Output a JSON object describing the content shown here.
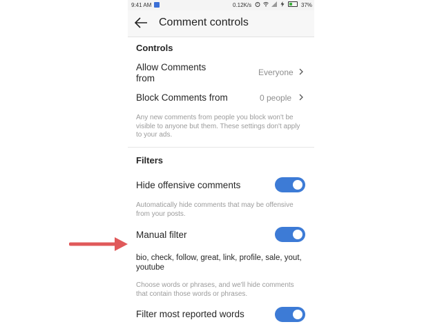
{
  "status_bar": {
    "time": "9:41 AM",
    "speed": "0.12K/s",
    "battery": "37%",
    "icons": [
      "alarm-icon",
      "wifi-icon",
      "signal-icon",
      "charging-icon",
      "battery-icon"
    ]
  },
  "header": {
    "title": "Comment controls",
    "back_icon": "back-arrow-icon"
  },
  "controls": {
    "section_title": "Controls",
    "allow_comments": {
      "label": "Allow Comments from",
      "value": "Everyone"
    },
    "block_comments": {
      "label": "Block Comments from",
      "value": "0 people"
    },
    "note": "Any new comments from people you block won't be visible to anyone but them. These settings don't apply to your ads."
  },
  "filters": {
    "section_title": "Filters",
    "hide_offensive": {
      "label": "Hide offensive comments",
      "enabled": true,
      "note": "Automatically hide comments that may be offensive from your posts."
    },
    "manual_filter": {
      "label": "Manual filter",
      "enabled": true,
      "words": "bio, check, follow, great, link, profile, sale, yout, youtube",
      "note": "Choose words or phrases, and we'll hide comments that contain those words or phrases."
    },
    "most_reported": {
      "label": "Filter most reported words",
      "enabled": true
    }
  },
  "colors": {
    "toggle_on": "#3d7bd6",
    "annotation_arrow": "#e0595a",
    "muted_text": "#8e8e8e"
  }
}
